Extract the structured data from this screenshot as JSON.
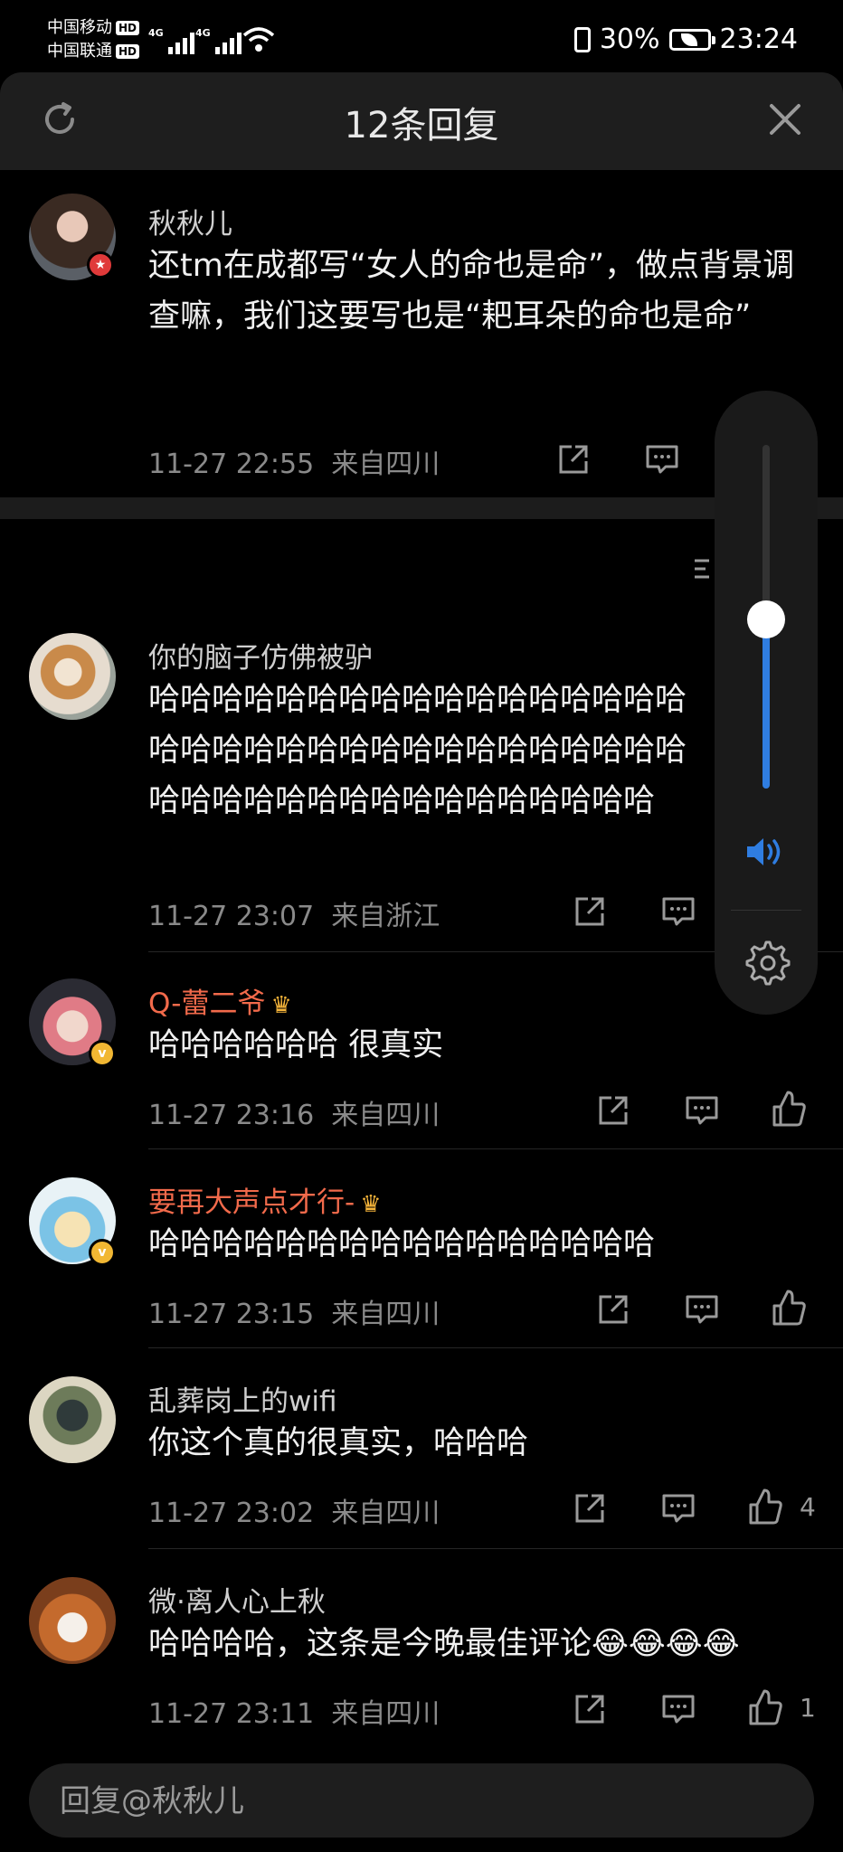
{
  "status_bar": {
    "carrier_1": "中国移动",
    "carrier_2": "中国联通",
    "hd": "HD",
    "net_1": "4G",
    "net_2": "4G",
    "battery": "30%",
    "time": "23:24"
  },
  "header": {
    "title": "12条回复"
  },
  "comments": [
    {
      "user": "秋秋儿",
      "text": "还tm在成都写“女人的命也是命”，做点背景调查嘛，我们这要写也是“耙耳朵的命也是命”",
      "time": "11-27 22:55",
      "location": "来自四川"
    },
    {
      "user": "你的脑子仿佛被驴",
      "text": "哈哈哈哈哈哈哈哈哈哈哈哈哈哈哈哈哈哈哈哈哈哈哈哈哈哈哈哈哈哈哈哈哈哈哈哈哈哈哈哈哈哈哈哈哈哈哈哈哈哈",
      "time": "11-27 23:07",
      "location": "来自浙江"
    },
    {
      "user": "Q-蕾二爷",
      "text": "哈哈哈哈哈哈 很真实",
      "time": "11-27 23:16",
      "location": "来自四川"
    },
    {
      "user": "要再大声点才行-",
      "text": "哈哈哈哈哈哈哈哈哈哈哈哈哈哈哈哈",
      "time": "11-27 23:15",
      "location": "来自四川"
    },
    {
      "user": "乱葬岗上的wifi",
      "text": "你这个真的很真实，哈哈哈",
      "time": "11-27 23:02",
      "location": "来自四川",
      "likes": "4"
    },
    {
      "user": "微·离人心上秋",
      "text": "哈哈哈哈，这条是今晚最佳评论😂😂😂😂",
      "time": "11-27 23:11",
      "location": "来自四川",
      "likes": "1"
    }
  ],
  "volume_panel": {
    "level": 0.51
  },
  "reply_bar": {
    "placeholder": "回复@秋秋儿"
  },
  "colors": {
    "background": "#000000",
    "header_bg": "#1e1e1e",
    "vip_name": "#f26a4b",
    "accent_blue": "#2f7de1"
  },
  "icons": [
    "refresh-icon",
    "close-icon",
    "share-icon",
    "comment-icon",
    "like-icon",
    "speaker-icon",
    "gear-icon",
    "crown-icon",
    "verified-icon"
  ]
}
